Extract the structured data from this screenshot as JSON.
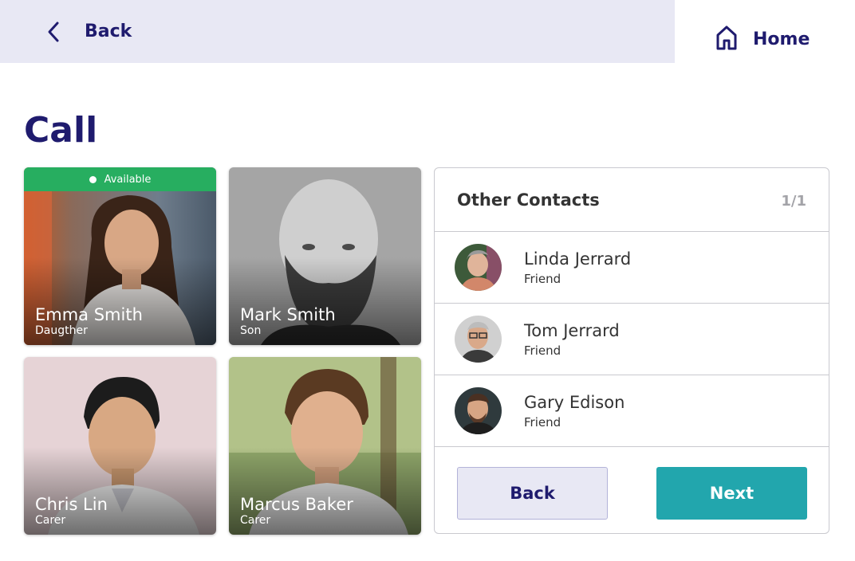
{
  "header": {
    "back_label": "Back",
    "home_label": "Home",
    "back_icon": "chevron-left-icon",
    "home_icon": "house-icon"
  },
  "page": {
    "title": "Call"
  },
  "favorites": [
    {
      "name": "Emma Smith",
      "relation": "Daugther",
      "status": "Available"
    },
    {
      "name": "Mark Smith",
      "relation": "Son"
    },
    {
      "name": "Chris Lin",
      "relation": "Carer"
    },
    {
      "name": "Marcus Baker",
      "relation": "Carer"
    }
  ],
  "other_contacts": {
    "title": "Other Contacts",
    "page_indicator": "1/1",
    "items": [
      {
        "name": "Linda Jerrard",
        "relation": "Friend"
      },
      {
        "name": "Tom Jerrard",
        "relation": "Friend"
      },
      {
        "name": "Gary Edison",
        "relation": "Friend"
      }
    ],
    "back_label": "Back",
    "next_label": "Next"
  },
  "colors": {
    "brand": "#1f1b6e",
    "available": "#27ae60",
    "next_button": "#22a6ad",
    "top_bar": "#e8e8f4"
  }
}
